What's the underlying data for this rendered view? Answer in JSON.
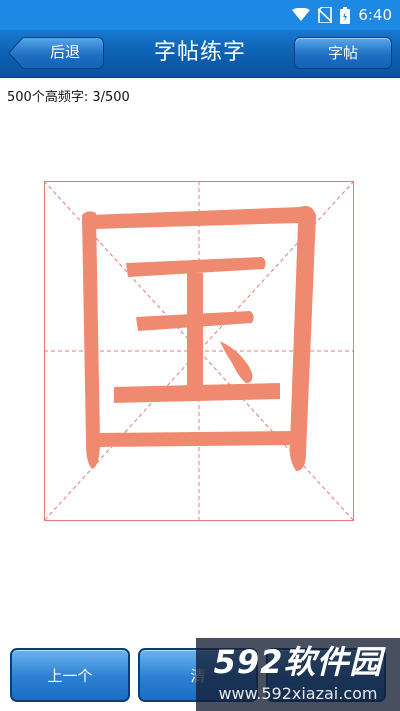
{
  "status_bar": {
    "time": "6:40",
    "icons": [
      "wifi-icon",
      "no-sim-icon",
      "battery-icon"
    ]
  },
  "nav": {
    "back_label": "后退",
    "title": "字帖练字",
    "right_label": "字帖"
  },
  "progress": {
    "text": "500个高频字: 3/500"
  },
  "practice": {
    "character": "国",
    "stroke_color": "#ef8a70",
    "grid_color": "#e57c74"
  },
  "bottom": {
    "prev_label": "上一个",
    "clear_label": "清"
  },
  "watermark": {
    "brand": "592软件园",
    "url": "www.592xiazai.com"
  },
  "colors": {
    "status_bar": "#1e88e5",
    "nav_bar": "#0d5fb0",
    "button_blue": "#2b7fd2"
  }
}
